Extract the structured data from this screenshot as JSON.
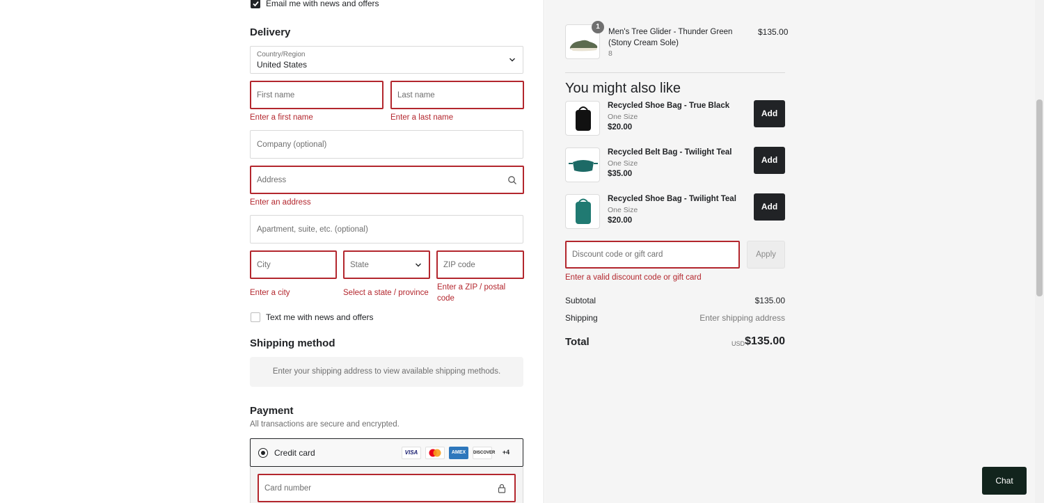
{
  "contact": {
    "email_opt_in_label": "Email me with news and offers",
    "email_opt_in_checked": true
  },
  "delivery": {
    "heading": "Delivery",
    "country": {
      "label": "Country/Region",
      "value": "United States"
    },
    "first_name": {
      "placeholder": "First name",
      "error": "Enter a first name"
    },
    "last_name": {
      "placeholder": "Last name",
      "error": "Enter a last name"
    },
    "company": {
      "placeholder": "Company (optional)"
    },
    "address": {
      "placeholder": "Address",
      "error": "Enter an address"
    },
    "apartment": {
      "placeholder": "Apartment, suite, etc. (optional)"
    },
    "city": {
      "placeholder": "City",
      "error": "Enter a city"
    },
    "state": {
      "placeholder": "State",
      "error": "Select a state / province"
    },
    "zip": {
      "placeholder": "ZIP code",
      "error": "Enter a ZIP / postal code"
    },
    "sms_opt_in_label": "Text me with news and offers",
    "sms_opt_in_checked": false
  },
  "shipping_method": {
    "heading": "Shipping method",
    "notice": "Enter your shipping address to view available shipping methods."
  },
  "payment": {
    "heading": "Payment",
    "subtitle": "All transactions are secure and encrypted.",
    "method_label": "Credit card",
    "card_brands": [
      "VISA",
      "mastercard-icon",
      "AMEX",
      "DISCOVER"
    ],
    "more_brands": "+4",
    "card_number_placeholder": "Card number"
  },
  "cart": {
    "item": {
      "title": "Men's Tree Glider - Thunder Green (Stony Cream Sole)",
      "variant": "8",
      "quantity": "1",
      "price": "$135.00"
    },
    "upsell_heading": "You might also like",
    "upsells": [
      {
        "title": "Recycled Shoe Bag - True Black",
        "size": "One Size",
        "price": "$20.00",
        "button": "Add",
        "color": "#111111"
      },
      {
        "title": "Recycled Belt Bag - Twilight Teal",
        "size": "One Size",
        "price": "$35.00",
        "button": "Add",
        "color": "#1d6a66"
      },
      {
        "title": "Recycled Shoe Bag - Twilight Teal",
        "size": "One Size",
        "price": "$20.00",
        "button": "Add",
        "color": "#207a72"
      }
    ],
    "discount": {
      "placeholder": "Discount code or gift card",
      "error": "Enter a valid discount code or gift card",
      "apply_label": "Apply"
    },
    "summary": {
      "subtotal_label": "Subtotal",
      "subtotal_value": "$135.00",
      "shipping_label": "Shipping",
      "shipping_value": "Enter shipping address",
      "total_label": "Total",
      "currency": "USD",
      "total_value": "$135.00"
    }
  },
  "chat": {
    "label": "Chat"
  },
  "colors": {
    "error": "#b3262d",
    "dark": "#212326",
    "panel": "#f5f5f5"
  }
}
